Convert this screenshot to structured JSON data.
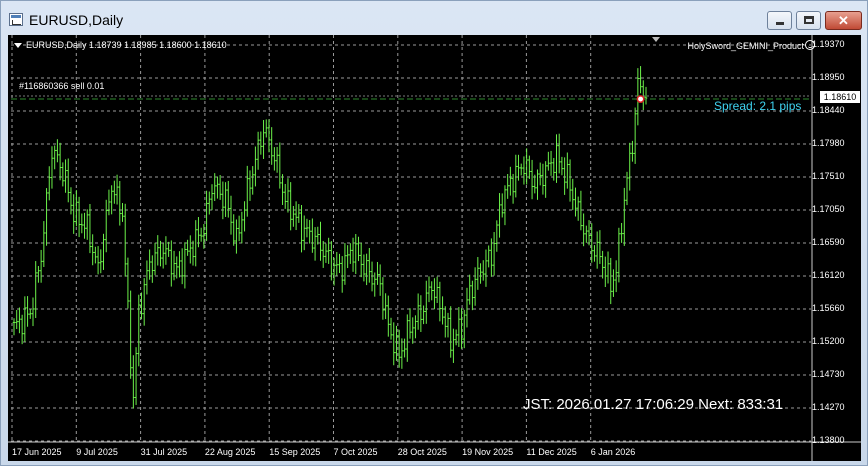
{
  "window": {
    "title": "EURUSD,Daily",
    "close_glyph": "✕"
  },
  "chart": {
    "ohlc_header": "EURUSD,Daily  1.18739 1.18985 1.18600 1.18610",
    "ea_name": "HolySword_GEMINI_Product",
    "order_label": "#116860366 sell 0.01",
    "current_price": "1.18610",
    "spread_text": "Spread: 2.1 pips",
    "jst_text": "JST: 2026.01.27 17:06:29 Next: 833:31",
    "colors": {
      "bars": "#6cf24a",
      "grid": "#9a9a9a",
      "order_line": "#2e8b2e",
      "spread": "#3fd3f1"
    }
  },
  "chart_data": {
    "type": "ohlc",
    "symbol": "EURUSD",
    "timeframe": "Daily",
    "y_ticks": [
      "1.19370",
      "1.18950",
      "1.18440",
      "1.17980",
      "1.17510",
      "1.17050",
      "1.16590",
      "1.16120",
      "1.15660",
      "1.15200",
      "1.14730",
      "1.14270",
      "1.13800"
    ],
    "x_ticks": [
      "17 Jun 2025",
      "9 Jul 2025",
      "31 Jul 2025",
      "22 Aug 2025",
      "15 Sep 2025",
      "7 Oct 2025",
      "28 Oct 2025",
      "19 Nov 2025",
      "11 Dec 2025",
      "6 Jan 2026"
    ],
    "ylim": [
      1.138,
      1.1937
    ],
    "close_anchors": [
      {
        "i": 0,
        "c": 1.154
      },
      {
        "i": 6,
        "c": 1.156
      },
      {
        "i": 10,
        "c": 1.164
      },
      {
        "i": 14,
        "c": 1.179
      },
      {
        "i": 18,
        "c": 1.176
      },
      {
        "i": 22,
        "c": 1.17
      },
      {
        "i": 27,
        "c": 1.168
      },
      {
        "i": 31,
        "c": 1.162
      },
      {
        "i": 36,
        "c": 1.174
      },
      {
        "i": 40,
        "c": 1.17
      },
      {
        "i": 42,
        "c": 1.156
      },
      {
        "i": 44,
        "c": 1.144
      },
      {
        "i": 46,
        "c": 1.156
      },
      {
        "i": 50,
        "c": 1.163
      },
      {
        "i": 55,
        "c": 1.165
      },
      {
        "i": 60,
        "c": 1.162
      },
      {
        "i": 65,
        "c": 1.165
      },
      {
        "i": 70,
        "c": 1.168
      },
      {
        "i": 73,
        "c": 1.174
      },
      {
        "i": 78,
        "c": 1.172
      },
      {
        "i": 82,
        "c": 1.166
      },
      {
        "i": 86,
        "c": 1.173
      },
      {
        "i": 90,
        "c": 1.179
      },
      {
        "i": 92,
        "c": 1.182
      },
      {
        "i": 96,
        "c": 1.178
      },
      {
        "i": 100,
        "c": 1.172
      },
      {
        "i": 106,
        "c": 1.168
      },
      {
        "i": 112,
        "c": 1.166
      },
      {
        "i": 117,
        "c": 1.163
      },
      {
        "i": 120,
        "c": 1.162
      },
      {
        "i": 125,
        "c": 1.165
      },
      {
        "i": 130,
        "c": 1.162
      },
      {
        "i": 135,
        "c": 1.16
      },
      {
        "i": 138,
        "c": 1.154
      },
      {
        "i": 142,
        "c": 1.15
      },
      {
        "i": 146,
        "c": 1.154
      },
      {
        "i": 150,
        "c": 1.156
      },
      {
        "i": 154,
        "c": 1.16
      },
      {
        "i": 158,
        "c": 1.156
      },
      {
        "i": 161,
        "c": 1.152
      },
      {
        "i": 165,
        "c": 1.154
      },
      {
        "i": 168,
        "c": 1.159
      },
      {
        "i": 172,
        "c": 1.162
      },
      {
        "i": 176,
        "c": 1.164
      },
      {
        "i": 180,
        "c": 1.172
      },
      {
        "i": 184,
        "c": 1.175
      },
      {
        "i": 188,
        "c": 1.177
      },
      {
        "i": 192,
        "c": 1.174
      },
      {
        "i": 196,
        "c": 1.176
      },
      {
        "i": 200,
        "c": 1.178
      },
      {
        "i": 204,
        "c": 1.175
      },
      {
        "i": 208,
        "c": 1.17
      },
      {
        "i": 212,
        "c": 1.166
      },
      {
        "i": 216,
        "c": 1.164
      },
      {
        "i": 220,
        "c": 1.16
      },
      {
        "i": 222,
        "c": 1.162
      },
      {
        "i": 225,
        "c": 1.172
      },
      {
        "i": 228,
        "c": 1.18
      },
      {
        "i": 230,
        "c": 1.188
      },
      {
        "i": 232,
        "c": 1.1875
      },
      {
        "i": 233,
        "c": 1.1861
      }
    ],
    "grid": true
  }
}
